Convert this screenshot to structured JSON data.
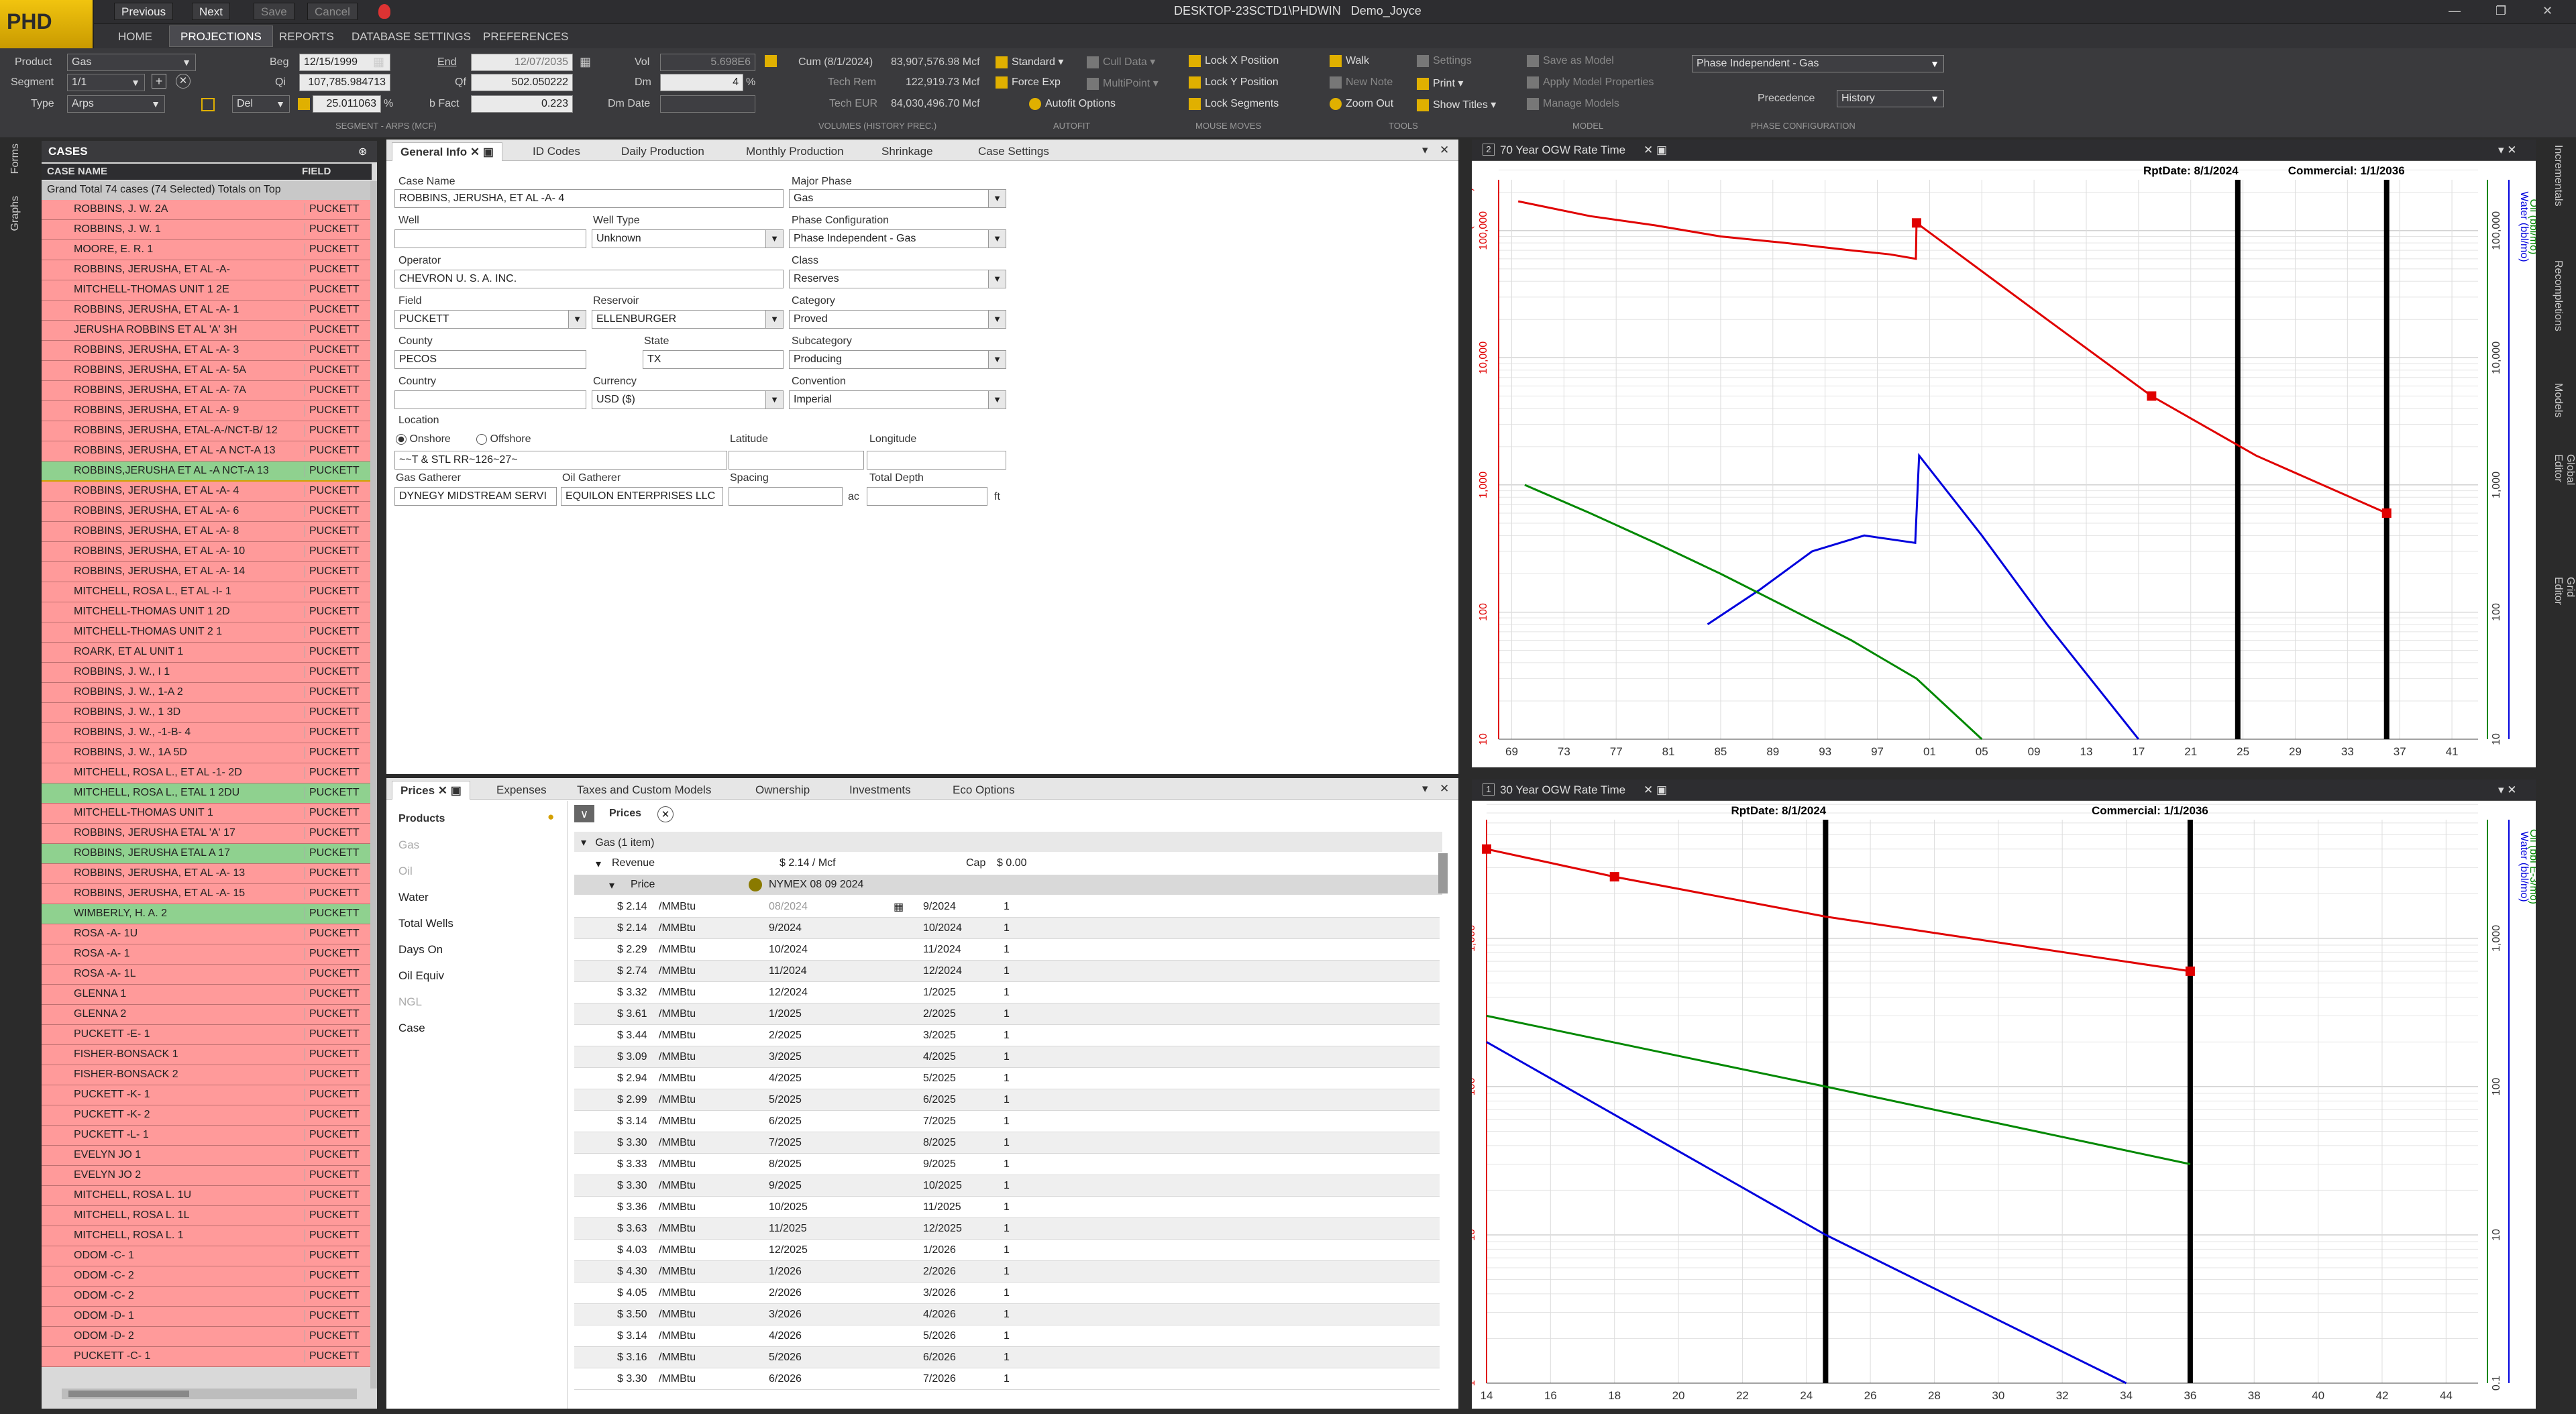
{
  "app": {
    "logo": "PHD",
    "title": "DESKTOP-23SCTD1\\PHDWIN",
    "user": "Demo_Joyce",
    "toolbar": [
      "Previous",
      "Next",
      "Save",
      "Cancel"
    ]
  },
  "menu": [
    "HOME",
    "PROJECTIONS",
    "REPORTS",
    "DATABASE SETTINGS",
    "PREFERENCES"
  ],
  "ribbon": {
    "product_label": "Product",
    "product": "Gas",
    "segment_label": "Segment",
    "segment": "1/1",
    "type_label": "Type",
    "type": "Arps",
    "beg_label": "Beg",
    "beg": "12/15/1999",
    "qi_label": "Qi",
    "qi": "107,785.984713",
    "del_label": "Del",
    "del_val": "25.011063",
    "del_unit": "%",
    "end_label": "End",
    "end": "12/07/2035",
    "qf_label": "Qf",
    "qf": "502.050222",
    "bfact_label": "b Fact",
    "bfact": "0.223",
    "vol_label": "Vol",
    "vol": "5.698E6",
    "dm_label": "Dm",
    "dm": "4",
    "dm_unit": "%",
    "dmdate_label": "Dm Date",
    "dmdate": "",
    "seg_group": "SEGMENT - ARPS (MCF)",
    "cum_label": "Cum (8/1/2024)",
    "cum": "83,907,576.98 Mcf",
    "techrem_label": "Tech Rem",
    "techrem": "122,919.73 Mcf",
    "techeur_label": "Tech EUR",
    "techeur": "84,030,496.70 Mcf",
    "vol_group": "VOLUMES (HISTORY PREC.)",
    "standard": "Standard",
    "cull": "Cull Data",
    "forceexp": "Force Exp",
    "multipoint": "MultiPoint",
    "autofit": "Autofit Options",
    "autofit_group": "AUTOFIT",
    "lockx": "Lock X Position",
    "locky": "Lock Y Position",
    "lockseg": "Lock Segments",
    "mouse_group": "MOUSE MOVES",
    "walk": "Walk",
    "settings": "Settings",
    "newnote": "New Note",
    "print": "Print",
    "zoomout": "Zoom Out",
    "showtitles": "Show Titles",
    "tools_group": "TOOLS",
    "saveasmodel": "Save as Model",
    "applymodel": "Apply Model Properties",
    "managemodels": "Manage Models",
    "model_group": "MODEL",
    "phasecfg": "Phase Independent - Gas",
    "precedence_label": "Precedence",
    "precedence": "History",
    "phase_group": "PHASE CONFIGURATION"
  },
  "sidetabs_left": [
    "Forms",
    "Graphs"
  ],
  "sidetabs_right": [
    "Incrementals",
    "Recompletions",
    "Models",
    "Global Editor",
    "Grid Editor"
  ],
  "cases": {
    "title": "CASES",
    "col_name": "CASE NAME",
    "col_field": "FIELD",
    "grand": "Grand Total  74 cases  (74 Selected)  Totals on Top",
    "rows": [
      [
        "ROBBINS, J. W. 2A",
        "PUCKETT",
        "red"
      ],
      [
        "ROBBINS, J. W. 1",
        "PUCKETT",
        "red"
      ],
      [
        "MOORE, E. R. 1",
        "PUCKETT",
        "red"
      ],
      [
        "ROBBINS, JERUSHA, ET AL -A-",
        "PUCKETT",
        "red"
      ],
      [
        "MITCHELL-THOMAS UNIT 1 2E",
        "PUCKETT",
        "red"
      ],
      [
        "ROBBINS, JERUSHA, ET AL -A- 1",
        "PUCKETT",
        "red"
      ],
      [
        "JERUSHA ROBBINS ET AL 'A' 3H",
        "PUCKETT",
        "red"
      ],
      [
        "ROBBINS, JERUSHA, ET AL -A- 3",
        "PUCKETT",
        "red"
      ],
      [
        "ROBBINS, JERUSHA, ET AL -A- 5A",
        "PUCKETT",
        "red"
      ],
      [
        "ROBBINS, JERUSHA, ET AL -A- 7A",
        "PUCKETT",
        "red"
      ],
      [
        "ROBBINS, JERUSHA, ET AL -A- 9",
        "PUCKETT",
        "red"
      ],
      [
        "ROBBINS, JERUSHA, ETAL-A-/NCT-B/ 12",
        "PUCKETT",
        "red"
      ],
      [
        "ROBBINS, JERUSHA, ET AL -A NCT-A 13",
        "PUCKETT",
        "red"
      ],
      [
        "ROBBINS,JERUSHA ET AL -A NCT-A 13",
        "PUCKETT",
        "green"
      ],
      [
        "ROBBINS, JERUSHA, ET AL -A- 4",
        "PUCKETT",
        "selred"
      ],
      [
        "ROBBINS, JERUSHA, ET AL -A- 6",
        "PUCKETT",
        "red"
      ],
      [
        "ROBBINS, JERUSHA, ET AL -A- 8",
        "PUCKETT",
        "red"
      ],
      [
        "ROBBINS, JERUSHA, ET AL -A- 10",
        "PUCKETT",
        "red"
      ],
      [
        "ROBBINS, JERUSHA, ET AL -A- 14",
        "PUCKETT",
        "red"
      ],
      [
        "MITCHELL, ROSA L., ET AL -I- 1",
        "PUCKETT",
        "red"
      ],
      [
        "MITCHELL-THOMAS UNIT 1 2D",
        "PUCKETT",
        "red"
      ],
      [
        "MITCHELL-THOMAS UNIT 2 1",
        "PUCKETT",
        "red"
      ],
      [
        "ROARK, ET AL UNIT 1",
        "PUCKETT",
        "red"
      ],
      [
        "ROBBINS, J. W., I 1",
        "PUCKETT",
        "red"
      ],
      [
        "ROBBINS, J. W., 1-A 2",
        "PUCKETT",
        "red"
      ],
      [
        "ROBBINS, J. W., 1 3D",
        "PUCKETT",
        "red"
      ],
      [
        "ROBBINS, J. W., -1-B- 4",
        "PUCKETT",
        "red"
      ],
      [
        "ROBBINS, J. W., 1A 5D",
        "PUCKETT",
        "red"
      ],
      [
        "MITCHELL, ROSA L., ET AL -1- 2D",
        "PUCKETT",
        "red"
      ],
      [
        "MITCHELL, ROSA L., ETAL 1 2DU",
        "PUCKETT",
        "green"
      ],
      [
        "MITCHELL-THOMAS UNIT 1",
        "PUCKETT",
        "red"
      ],
      [
        "ROBBINS, JERUSHA ETAL 'A' 17",
        "PUCKETT",
        "red"
      ],
      [
        "ROBBINS, JERUSHA ETAL A 17",
        "PUCKETT",
        "green"
      ],
      [
        "ROBBINS, JERUSHA, ET AL -A- 13",
        "PUCKETT",
        "red"
      ],
      [
        "ROBBINS, JERUSHA, ET AL -A- 15",
        "PUCKETT",
        "red"
      ],
      [
        "WIMBERLY, H. A. 2",
        "PUCKETT",
        "green"
      ],
      [
        "ROSA -A- 1U",
        "PUCKETT",
        "red"
      ],
      [
        "ROSA -A- 1",
        "PUCKETT",
        "red"
      ],
      [
        "ROSA -A- 1L",
        "PUCKETT",
        "red"
      ],
      [
        "GLENNA 1",
        "PUCKETT",
        "red"
      ],
      [
        "GLENNA 2",
        "PUCKETT",
        "red"
      ],
      [
        "PUCKETT -E- 1",
        "PUCKETT",
        "red"
      ],
      [
        "FISHER-BONSACK 1",
        "PUCKETT",
        "red"
      ],
      [
        "FISHER-BONSACK 2",
        "PUCKETT",
        "red"
      ],
      [
        "PUCKETT -K- 1",
        "PUCKETT",
        "red"
      ],
      [
        "PUCKETT -K- 2",
        "PUCKETT",
        "red"
      ],
      [
        "PUCKETT -L- 1",
        "PUCKETT",
        "red"
      ],
      [
        "EVELYN JO 1",
        "PUCKETT",
        "red"
      ],
      [
        "EVELYN JO 2",
        "PUCKETT",
        "red"
      ],
      [
        "MITCHELL, ROSA L. 1U",
        "PUCKETT",
        "red"
      ],
      [
        "MITCHELL, ROSA L. 1L",
        "PUCKETT",
        "red"
      ],
      [
        "MITCHELL, ROSA L. 1",
        "PUCKETT",
        "red"
      ],
      [
        "ODOM -C- 1",
        "PUCKETT",
        "red"
      ],
      [
        "ODOM -C- 2",
        "PUCKETT",
        "red"
      ],
      [
        "ODOM -C- 2",
        "PUCKETT",
        "red"
      ],
      [
        "ODOM -D- 1",
        "PUCKETT",
        "red"
      ],
      [
        "ODOM -D- 2",
        "PUCKETT",
        "red"
      ],
      [
        "PUCKETT -C- 1",
        "PUCKETT",
        "red"
      ]
    ]
  },
  "general": {
    "tabs": [
      "General Info",
      "ID Codes",
      "Daily Production",
      "Monthly Production",
      "Shrinkage",
      "Case Settings"
    ],
    "casename_label": "Case Name",
    "casename": "ROBBINS, JERUSHA, ET AL -A- 4",
    "majorphase_label": "Major Phase",
    "majorphase": "Gas",
    "well_label": "Well",
    "well": "",
    "welltype_label": "Well Type",
    "welltype": "Unknown",
    "phasecfg_label": "Phase Configuration",
    "phasecfg": "Phase Independent - Gas",
    "operator_label": "Operator",
    "operator": "CHEVRON U. S. A. INC.",
    "class_label": "Class",
    "class": "Reserves",
    "field_label": "Field",
    "field": "PUCKETT",
    "reservoir_label": "Reservoir",
    "reservoir": "ELLENBURGER",
    "category_label": "Category",
    "category": "Proved",
    "county_label": "County",
    "county": "PECOS",
    "state_label": "State",
    "state": "TX",
    "subcategory_label": "Subcategory",
    "subcategory": "Producing",
    "country_label": "Country",
    "country": "",
    "currency_label": "Currency",
    "currency": "USD ($)",
    "convention_label": "Convention",
    "convention": "Imperial",
    "location_label": "Location",
    "onshore": "Onshore",
    "offshore": "Offshore",
    "latitude_label": "Latitude",
    "longitude_label": "Longitude",
    "location": "~~T & STL RR~126~27~",
    "gasgath_label": "Gas Gatherer",
    "gasgath": "DYNEGY MIDSTREAM SERVI",
    "oilgath_label": "Oil Gatherer",
    "oilgath": "EQUILON ENTERPRISES LLC",
    "spacing_label": "Spacing",
    "spacing_unit": "ac",
    "depth_label": "Total Depth",
    "depth_unit": "ft"
  },
  "prices": {
    "tabs": [
      "Prices",
      "Expenses",
      "Taxes and Custom Models",
      "Ownership",
      "Investments",
      "Eco Options"
    ],
    "products_label": "Products",
    "products": [
      "Gas",
      "Oil",
      "Water",
      "Total Wells",
      "Days On",
      "Oil Equiv",
      "NGL",
      "Case"
    ],
    "prices_label": "Prices",
    "gas_group": "Gas (1 item)",
    "revenue_label": "Revenue",
    "revenue": "$ 2.14 / Mcf",
    "cap_label": "Cap",
    "cap": "$ 0.00",
    "price_label": "Price",
    "price_src": "NYMEX 08 09 2024",
    "rows": [
      [
        "$ 2.14",
        "/MMBtu",
        "08/2024",
        "9/2024",
        "1"
      ],
      [
        "$ 2.14",
        "/MMBtu",
        "9/2024",
        "10/2024",
        "1"
      ],
      [
        "$ 2.29",
        "/MMBtu",
        "10/2024",
        "11/2024",
        "1"
      ],
      [
        "$ 2.74",
        "/MMBtu",
        "11/2024",
        "12/2024",
        "1"
      ],
      [
        "$ 3.32",
        "/MMBtu",
        "12/2024",
        "1/2025",
        "1"
      ],
      [
        "$ 3.61",
        "/MMBtu",
        "1/2025",
        "2/2025",
        "1"
      ],
      [
        "$ 3.44",
        "/MMBtu",
        "2/2025",
        "3/2025",
        "1"
      ],
      [
        "$ 3.09",
        "/MMBtu",
        "3/2025",
        "4/2025",
        "1"
      ],
      [
        "$ 2.94",
        "/MMBtu",
        "4/2025",
        "5/2025",
        "1"
      ],
      [
        "$ 2.99",
        "/MMBtu",
        "5/2025",
        "6/2025",
        "1"
      ],
      [
        "$ 3.14",
        "/MMBtu",
        "6/2025",
        "7/2025",
        "1"
      ],
      [
        "$ 3.30",
        "/MMBtu",
        "7/2025",
        "8/2025",
        "1"
      ],
      [
        "$ 3.33",
        "/MMBtu",
        "8/2025",
        "9/2025",
        "1"
      ],
      [
        "$ 3.30",
        "/MMBtu",
        "9/2025",
        "10/2025",
        "1"
      ],
      [
        "$ 3.36",
        "/MMBtu",
        "10/2025",
        "11/2025",
        "1"
      ],
      [
        "$ 3.63",
        "/MMBtu",
        "11/2025",
        "12/2025",
        "1"
      ],
      [
        "$ 4.03",
        "/MMBtu",
        "12/2025",
        "1/2026",
        "1"
      ],
      [
        "$ 4.30",
        "/MMBtu",
        "1/2026",
        "2/2026",
        "1"
      ],
      [
        "$ 4.05",
        "/MMBtu",
        "2/2026",
        "3/2026",
        "1"
      ],
      [
        "$ 3.50",
        "/MMBtu",
        "3/2026",
        "4/2026",
        "1"
      ],
      [
        "$ 3.14",
        "/MMBtu",
        "4/2026",
        "5/2026",
        "1"
      ],
      [
        "$ 3.16",
        "/MMBtu",
        "5/2026",
        "6/2026",
        "1"
      ],
      [
        "$ 3.30",
        "/MMBtu",
        "6/2026",
        "7/2026",
        "1"
      ]
    ]
  },
  "chart_data": [
    {
      "type": "line",
      "title": "70 Year OGW Rate Time",
      "rptdate": "RptDate: 8/1/2024",
      "commercial": "Commercial: 1/1/2036",
      "ylabel_left": "Gas (Mcf/mo)",
      "ylabel_right1": "Water (bbl/mo)",
      "ylabel_right2": "Oil (bbl/mo)",
      "yticks": [
        "10",
        "100",
        "1,000",
        "10,000",
        "100,000"
      ],
      "yticks_right": [
        "10",
        "100",
        "1,000",
        "10,000",
        "100,000"
      ],
      "xticks": [
        "69",
        "73",
        "77",
        "81",
        "85",
        "89",
        "93",
        "97",
        "01",
        "05",
        "09",
        "13",
        "17",
        "21",
        "25",
        "29",
        "33",
        "37",
        "41"
      ],
      "series": [
        {
          "name": "Gas",
          "color": "#e00000",
          "x": [
            1969.5,
            1975,
            1980,
            1985,
            1990,
            1995,
            1998,
            1999.95,
            2000,
            2010,
            2018,
            2026,
            2036
          ],
          "y": [
            170000,
            130000,
            110000,
            90000,
            80000,
            70000,
            65000,
            60000,
            115000,
            20000,
            5000,
            1700,
            600
          ]
        },
        {
          "name": "Water",
          "color": "#0000dd",
          "x": [
            1984,
            1988,
            1992,
            1996,
            1999.9,
            2000.2,
            2005,
            2010,
            2017
          ],
          "y": [
            80,
            150,
            300,
            400,
            350,
            1700,
            400,
            80,
            10
          ]
        },
        {
          "name": "Oil",
          "color": "#008800",
          "x": [
            1970,
            1975,
            1980,
            1985,
            1990,
            1995,
            2000,
            2005
          ],
          "y": [
            1000,
            600,
            350,
            200,
            110,
            60,
            30,
            10
          ]
        }
      ]
    },
    {
      "type": "line",
      "title": "30 Year OGW Rate Time",
      "rptdate": "RptDate: 8/1/2024",
      "commercial": "Commercial: 1/1/2036",
      "ylabel_left": "Gas (Mcf/mo)",
      "ylabel_right1": "Water (bbl/mo)",
      "ylabel_right2": "Oil (bbl E-3/mo)",
      "yticks": [
        "1",
        "10",
        "100",
        "1,000"
      ],
      "yticks_right": [
        "0.1",
        "10",
        "100",
        "1,000"
      ],
      "xticks": [
        "14",
        "16",
        "18",
        "20",
        "22",
        "24",
        "26",
        "28",
        "30",
        "32",
        "34",
        "36",
        "38",
        "40",
        "42",
        "44"
      ],
      "series": [
        {
          "name": "Gas",
          "color": "#e00000",
          "x": [
            2014,
            2018,
            2024.6,
            2036
          ],
          "y": [
            4000,
            2600,
            1400,
            600
          ]
        },
        {
          "name": "Oil",
          "color": "#008800",
          "x": [
            2014,
            2024.6,
            2036
          ],
          "y": [
            300,
            100,
            30
          ]
        },
        {
          "name": "Water",
          "color": "#0000dd",
          "x": [
            2014,
            2024.6,
            2034
          ],
          "y": [
            200,
            10,
            1
          ]
        }
      ]
    }
  ]
}
